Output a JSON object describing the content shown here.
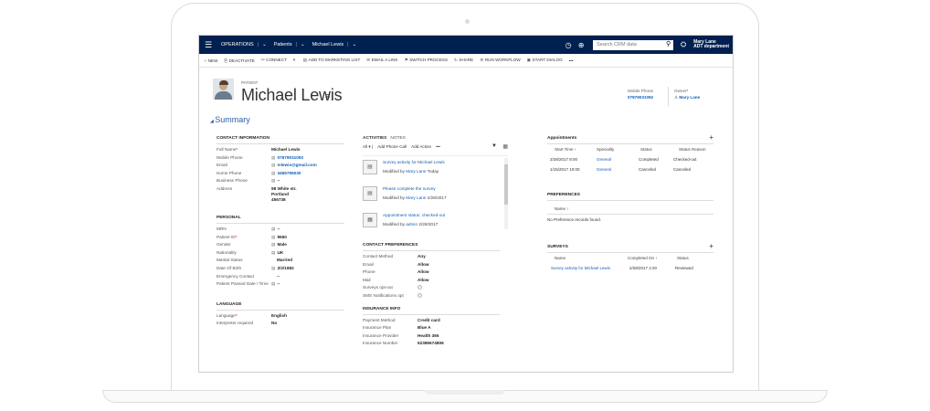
{
  "nav": {
    "app": "OPERATIONS",
    "entity": "Patients",
    "record": "Michael Lewis",
    "search_placeholder": "Search CRM data",
    "user_name": "Mary Lane",
    "user_dept": "ADT department"
  },
  "commands": [
    {
      "icon": "+",
      "label": "NEW"
    },
    {
      "icon": "⎘",
      "label": "DEACTIVATE"
    },
    {
      "icon": "⚯",
      "label": "CONNECT"
    },
    {
      "icon": "▾",
      "label": ""
    },
    {
      "icon": "▤",
      "label": "ADD TO MARKETING LIST"
    },
    {
      "icon": "✉",
      "label": "EMAIL A LINK"
    },
    {
      "icon": "⚑",
      "label": "SWITCH PROCESS"
    },
    {
      "icon": "↻",
      "label": "SHARE"
    },
    {
      "icon": "⚙",
      "label": "RUN WORKFLOW"
    },
    {
      "icon": "▣",
      "label": "START DIALOG"
    },
    {
      "icon": "",
      "label": "•••"
    }
  ],
  "header": {
    "entity_type": "PATIENT",
    "name": "Michael Lewis",
    "mobile_label": "Mobile Phone",
    "mobile_value": "07879031092",
    "owner_label": "Owner",
    "owner_value": "Mary Lane"
  },
  "summary_title": "Summary",
  "contact": {
    "title": "CONTACT INFORMATION",
    "fields": [
      {
        "label": "Full Name",
        "value": "Michael Lewis",
        "required": true
      },
      {
        "label": "Mobile Phone",
        "value": "07879031092",
        "link": true
      },
      {
        "label": "Email",
        "value": "mlewis@gmail.com",
        "link": true
      },
      {
        "label": "Home Phone",
        "value": "3465795030",
        "link": true
      },
      {
        "label": "Business Phone",
        "value": "--"
      },
      {
        "label": "Address",
        "value": "98 White str.",
        "value2": "Portland",
        "value3": "456738"
      }
    ]
  },
  "personal": {
    "title": "PERSONAL",
    "fields": [
      {
        "label": "MRN",
        "value": "--"
      },
      {
        "label": "Patient ID",
        "value": "9550",
        "required": true
      },
      {
        "label": "Gender",
        "value": "Male"
      },
      {
        "label": "Nationality",
        "value": "UK"
      },
      {
        "label": "Marital Status",
        "value": "Married"
      },
      {
        "label": "Date Of Birth",
        "value": "2/2/1982"
      },
      {
        "label": "Emergency Contact",
        "value": "--"
      },
      {
        "label": "Patient Passed Date / Time",
        "value": "--"
      }
    ]
  },
  "language": {
    "title": "LANGUAGE",
    "fields": [
      {
        "label": "Language",
        "value": "English",
        "required": true
      },
      {
        "label": "Interpreter required",
        "value": "No"
      }
    ]
  },
  "activities": {
    "tab_activities": "ACTIVITIES",
    "tab_notes": "NOTES",
    "filter_all": "All",
    "add_phone": "Add Phone Call",
    "add_action": "Add Action",
    "more": "•••",
    "items": [
      {
        "title": "Survey activity for Michael Lewis",
        "prefix": "Modified by",
        "who": "Mary Lane",
        "when": "Today"
      },
      {
        "title": "Please complete the survey",
        "prefix": "Modified by",
        "who": "Mary Lane",
        "when": "2/28/2017"
      },
      {
        "title": "Appointment status: checked-out",
        "prefix": "Modified by",
        "who": "admin",
        "when": "2/28/2017"
      }
    ]
  },
  "contact_prefs": {
    "title": "CONTACT PREFERENCES",
    "fields": [
      {
        "label": "Contact Method",
        "value": "Any"
      },
      {
        "label": "Email",
        "value": "Allow"
      },
      {
        "label": "Phone",
        "value": "Allow"
      },
      {
        "label": "Mail",
        "value": "Allow"
      },
      {
        "label": "Surveys opt-out",
        "value": ""
      },
      {
        "label": "SMS Notifications opt",
        "value": ""
      }
    ]
  },
  "insurance": {
    "title": "INSURANCE INFO",
    "fields": [
      {
        "label": "Payment Method",
        "value": "Credit card"
      },
      {
        "label": "Insurance Plan",
        "value": "Blue A"
      },
      {
        "label": "Insurance Provider",
        "value": "Health 365"
      },
      {
        "label": "Insurance Number",
        "value": "52385674806"
      }
    ]
  },
  "appointments": {
    "title": "Appointments",
    "headers": [
      "Start Time ↑",
      "Speciality",
      "Status",
      "Status Reason"
    ],
    "rows": [
      [
        "2/28/2017 8:00",
        "General",
        "Completed",
        "Checked-out"
      ],
      [
        "1/15/2017 10:00",
        "General",
        "Canceled",
        "Canceled"
      ]
    ]
  },
  "preferences": {
    "title": "PREFERENCES",
    "header": "Name ↑",
    "empty": "No Preference records found."
  },
  "surveys": {
    "title": "SURVEYS",
    "headers": [
      "Name",
      "Completed On ↑",
      "Status"
    ],
    "rows": [
      [
        "Survey activity for Michael Lewis",
        "2/28/2017 2:20",
        "Reviewed"
      ]
    ]
  }
}
